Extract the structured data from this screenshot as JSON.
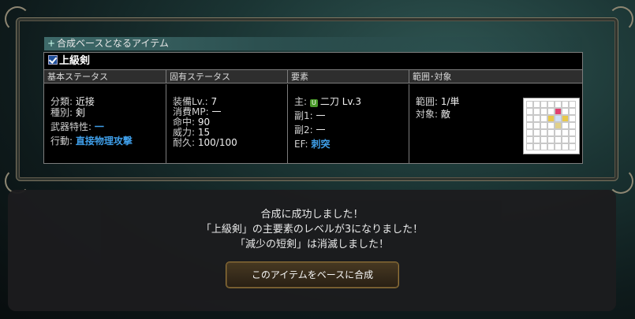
{
  "section": {
    "title": "合成ベースとなるアイテム"
  },
  "item": {
    "name": "上級剣"
  },
  "columns": {
    "basic": "基本ステータス",
    "unique": "固有ステータス",
    "element": "要素",
    "range": "範囲･対象"
  },
  "basic": {
    "category_label": "分類:",
    "category_value": "近接",
    "type_label": "種別:",
    "type_value": "剣",
    "trait_label": "武器特性:",
    "trait_value": "一",
    "action_label": "行動:",
    "action_value": "直接物理攻撃"
  },
  "unique": {
    "lv_label": "装備Lv.:",
    "lv_value": "7",
    "mp_label": "消費MP:",
    "mp_value": "一",
    "hit_label": "命中:",
    "hit_value": "90",
    "power_label": "威力:",
    "power_value": "15",
    "dur_label": "耐久:",
    "dur_value": "100/100"
  },
  "element": {
    "main_label": "主:",
    "main_badge": "U",
    "main_value": "二刀 Lv.3",
    "sub1_label": "副1:",
    "sub1_value": "一",
    "sub2_label": "副2:",
    "sub2_value": "一",
    "ef_label": "EF:",
    "ef_value": "刺突"
  },
  "range": {
    "range_label": "範囲:",
    "range_value": "1/単",
    "target_label": "対象:",
    "target_value": "敵"
  },
  "dialog": {
    "line1": "合成に成功しました！",
    "line2": "「上級剣」の主要素のレベルが3になりました！",
    "line3": "「減少の短剣」は消滅しました！",
    "button": "このアイテムをベースに合成"
  }
}
